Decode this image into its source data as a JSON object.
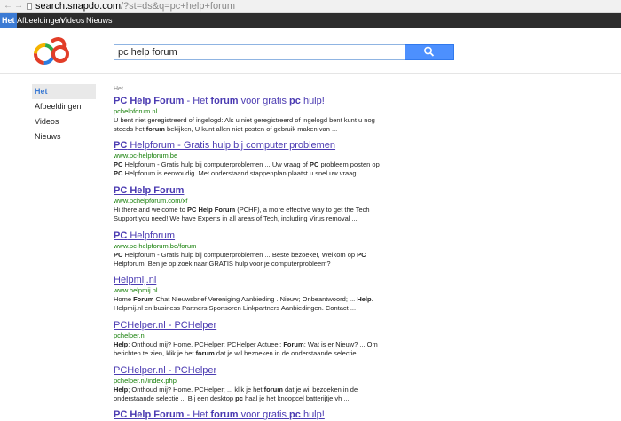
{
  "browser": {
    "back_glyph": "←",
    "forward_glyph": "→",
    "url_domain": "search.snapdo.com",
    "url_rest": "/?st=ds&q=pc+help+forum"
  },
  "topnav": {
    "items": [
      {
        "label": "Het",
        "active": true
      },
      {
        "label": "Afbeeldingen",
        "active": false
      },
      {
        "label": "Videos",
        "active": false
      },
      {
        "label": "Nieuws",
        "active": false
      }
    ]
  },
  "search": {
    "query": "pc help forum",
    "button_icon": "search-icon"
  },
  "sidebar": {
    "items": [
      {
        "label": "Het",
        "active": true
      },
      {
        "label": "Afbeeldingen",
        "active": false
      },
      {
        "label": "Videos",
        "active": false
      },
      {
        "label": "Nieuws",
        "active": false
      }
    ]
  },
  "results_label": "Het",
  "results": [
    {
      "title_parts": [
        {
          "t": "PC Help Forum",
          "b": true
        },
        {
          "t": " - Het ",
          "b": false
        },
        {
          "t": "forum",
          "b": true
        },
        {
          "t": " voor gratis ",
          "b": false
        },
        {
          "t": "pc",
          "b": true
        },
        {
          "t": " hulp!",
          "b": false
        }
      ],
      "url": "pchelpforum.nl",
      "snippet_parts": [
        {
          "t": "U bent niet geregistreerd of ingelogd: Als u niet geregistreerd of ingelogd bent kunt u nog steeds het ",
          "b": false
        },
        {
          "t": "forum",
          "b": true
        },
        {
          "t": " bekijken, U kunt allen niet posten of gebruik maken van ...",
          "b": false
        }
      ]
    },
    {
      "title_parts": [
        {
          "t": "PC",
          "b": true
        },
        {
          "t": " Helpforum - Gratis hulp bij computer problemen",
          "b": false
        }
      ],
      "url": "www.pc-helpforum.be",
      "snippet_parts": [
        {
          "t": "PC",
          "b": true
        },
        {
          "t": " Helpforum - Gratis hulp bij computerproblemen ... Uw vraag of ",
          "b": false
        },
        {
          "t": "PC",
          "b": true
        },
        {
          "t": " probleem posten op ",
          "b": false
        },
        {
          "t": "PC",
          "b": true
        },
        {
          "t": " Helpforum is eenvoudig. Met onderstaand stappenplan plaatst u snel uw vraag ...",
          "b": false
        }
      ]
    },
    {
      "title_parts": [
        {
          "t": "PC Help Forum",
          "b": true
        }
      ],
      "url": "www.pchelpforum.com/xf",
      "snippet_parts": [
        {
          "t": "Hi there and welcome to ",
          "b": false
        },
        {
          "t": "PC Help Forum",
          "b": true
        },
        {
          "t": " (PCHF), a more effective way to get the Tech Support you need! We have Experts in all areas of Tech, including Virus removal ...",
          "b": false
        }
      ]
    },
    {
      "title_parts": [
        {
          "t": "PC",
          "b": true
        },
        {
          "t": " Helpforum",
          "b": false
        }
      ],
      "url": "www.pc-helpforum.be/forum",
      "snippet_parts": [
        {
          "t": "PC",
          "b": true
        },
        {
          "t": " Helpforum - Gratis hulp bij computerproblemen ... Beste bezoeker, Welkom op ",
          "b": false
        },
        {
          "t": "PC",
          "b": true
        },
        {
          "t": " Helpforum! Ben je op zoek naar GRATIS hulp voor je computerprobleem?",
          "b": false
        }
      ]
    },
    {
      "title_parts": [
        {
          "t": "Helpmij.nl",
          "b": false
        }
      ],
      "url": "www.helpmij.nl",
      "snippet_parts": [
        {
          "t": "Home ",
          "b": false
        },
        {
          "t": "Forum",
          "b": true
        },
        {
          "t": " Chat Nieuwsbrief Vereniging Aanbieding . Nieuw; Onbeantwoord; ... ",
          "b": false
        },
        {
          "t": "Help",
          "b": true
        },
        {
          "t": ". Helpmij.nl en business Partners Sponsoren Linkpartners Aanbiedingen. Contact ...",
          "b": false
        }
      ]
    },
    {
      "title_parts": [
        {
          "t": "PCHelper.nl - PCHelper",
          "b": false
        }
      ],
      "url": "pchelper.nl",
      "snippet_parts": [
        {
          "t": "Help",
          "b": true
        },
        {
          "t": "; Onthoud mij? Home. PCHelper; PCHelper Actueel; ",
          "b": false
        },
        {
          "t": "Forum",
          "b": true
        },
        {
          "t": "; Wat is er Nieuw? ... Om berichten te zien, klik je het ",
          "b": false
        },
        {
          "t": "forum",
          "b": true
        },
        {
          "t": " dat je wil bezoeken in de onderstaande selectie.",
          "b": false
        }
      ]
    },
    {
      "title_parts": [
        {
          "t": "PCHelper.nl - PCHelper",
          "b": false
        }
      ],
      "url": "pchelper.nl/index.php",
      "snippet_parts": [
        {
          "t": "Help",
          "b": true
        },
        {
          "t": "; Onthoud mij? Home. PCHelper; ... klik je het ",
          "b": false
        },
        {
          "t": "forum",
          "b": true
        },
        {
          "t": " dat je wil bezoeken in de onderstaande selectie ... Bij een desktop ",
          "b": false
        },
        {
          "t": "pc",
          "b": true
        },
        {
          "t": " haal je het knoopcel batterijtje vh ...",
          "b": false
        }
      ]
    },
    {
      "title_parts": [
        {
          "t": "PC Help Forum",
          "b": true
        },
        {
          "t": " - Het ",
          "b": false
        },
        {
          "t": "forum",
          "b": true
        },
        {
          "t": " voor gratis ",
          "b": false
        },
        {
          "t": "pc",
          "b": true
        },
        {
          "t": " hulp!",
          "b": false
        }
      ],
      "url": "",
      "snippet_parts": []
    }
  ],
  "colors": {
    "accent": "#3c7bd4",
    "link": "#4b3bb2",
    "url_green": "#17800a",
    "topbar": "#2d2d2d",
    "button": "#4d90fe"
  }
}
